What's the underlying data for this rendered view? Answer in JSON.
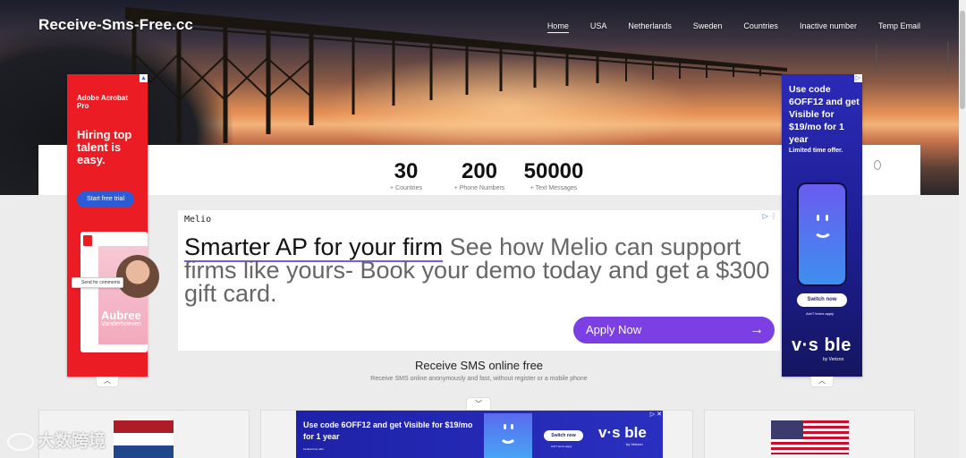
{
  "header": {
    "brand": "Receive-Sms-Free.cc",
    "nav": [
      "Home",
      "USA",
      "Netherlands",
      "Sweden",
      "Countries",
      "Inactive number",
      "Temp Email"
    ]
  },
  "stats": [
    {
      "value": "30",
      "label": "+ Countries"
    },
    {
      "value": "200",
      "label": "+ Phone Numbers"
    },
    {
      "value": "50000",
      "label": "+ Text Messages"
    }
  ],
  "ad_left": {
    "brand": "Adobe Acrobat Pro",
    "headline": "Hiring top talent is easy.",
    "cta": "Start free trial",
    "comments": "Send for comments",
    "name": "Aubree",
    "surname": "Vanderhoeven"
  },
  "ad_right": {
    "headline": "Use code 6OFF12 and get Visible for $19/mo for 1 year",
    "sub": "Limited time offer.",
    "cta": "Switch now",
    "terms": "AdvT terms apply",
    "logo": "v·s ble",
    "verizon": "by Verizon"
  },
  "center_ad": {
    "advertiser": "Melio",
    "headline": "Smarter AP for your firm",
    "body": "See how Melio can support firms like yours- Book your demo today and get a $300 gift card.",
    "cta": "Apply Now",
    "arrow": "→"
  },
  "section": {
    "title": "Receive SMS online free",
    "subtitle": "Receive SMS online anonymously and fast, without register or a mobile phone"
  },
  "bottom_ad": {
    "headline": "Use code 6OFF12 and get Visible for $19/mo for 1 year",
    "mini": "Limited time offer.",
    "cta": "Switch now",
    "terms": "AdvT terms apply",
    "logo": "v·s ble",
    "verizon": "by Verizon"
  },
  "watermark": "大数跨境",
  "colors": {
    "accent": "#7b3fe4",
    "adobe_red": "#ec1c24",
    "visible_blue": "#1d1d8e"
  }
}
